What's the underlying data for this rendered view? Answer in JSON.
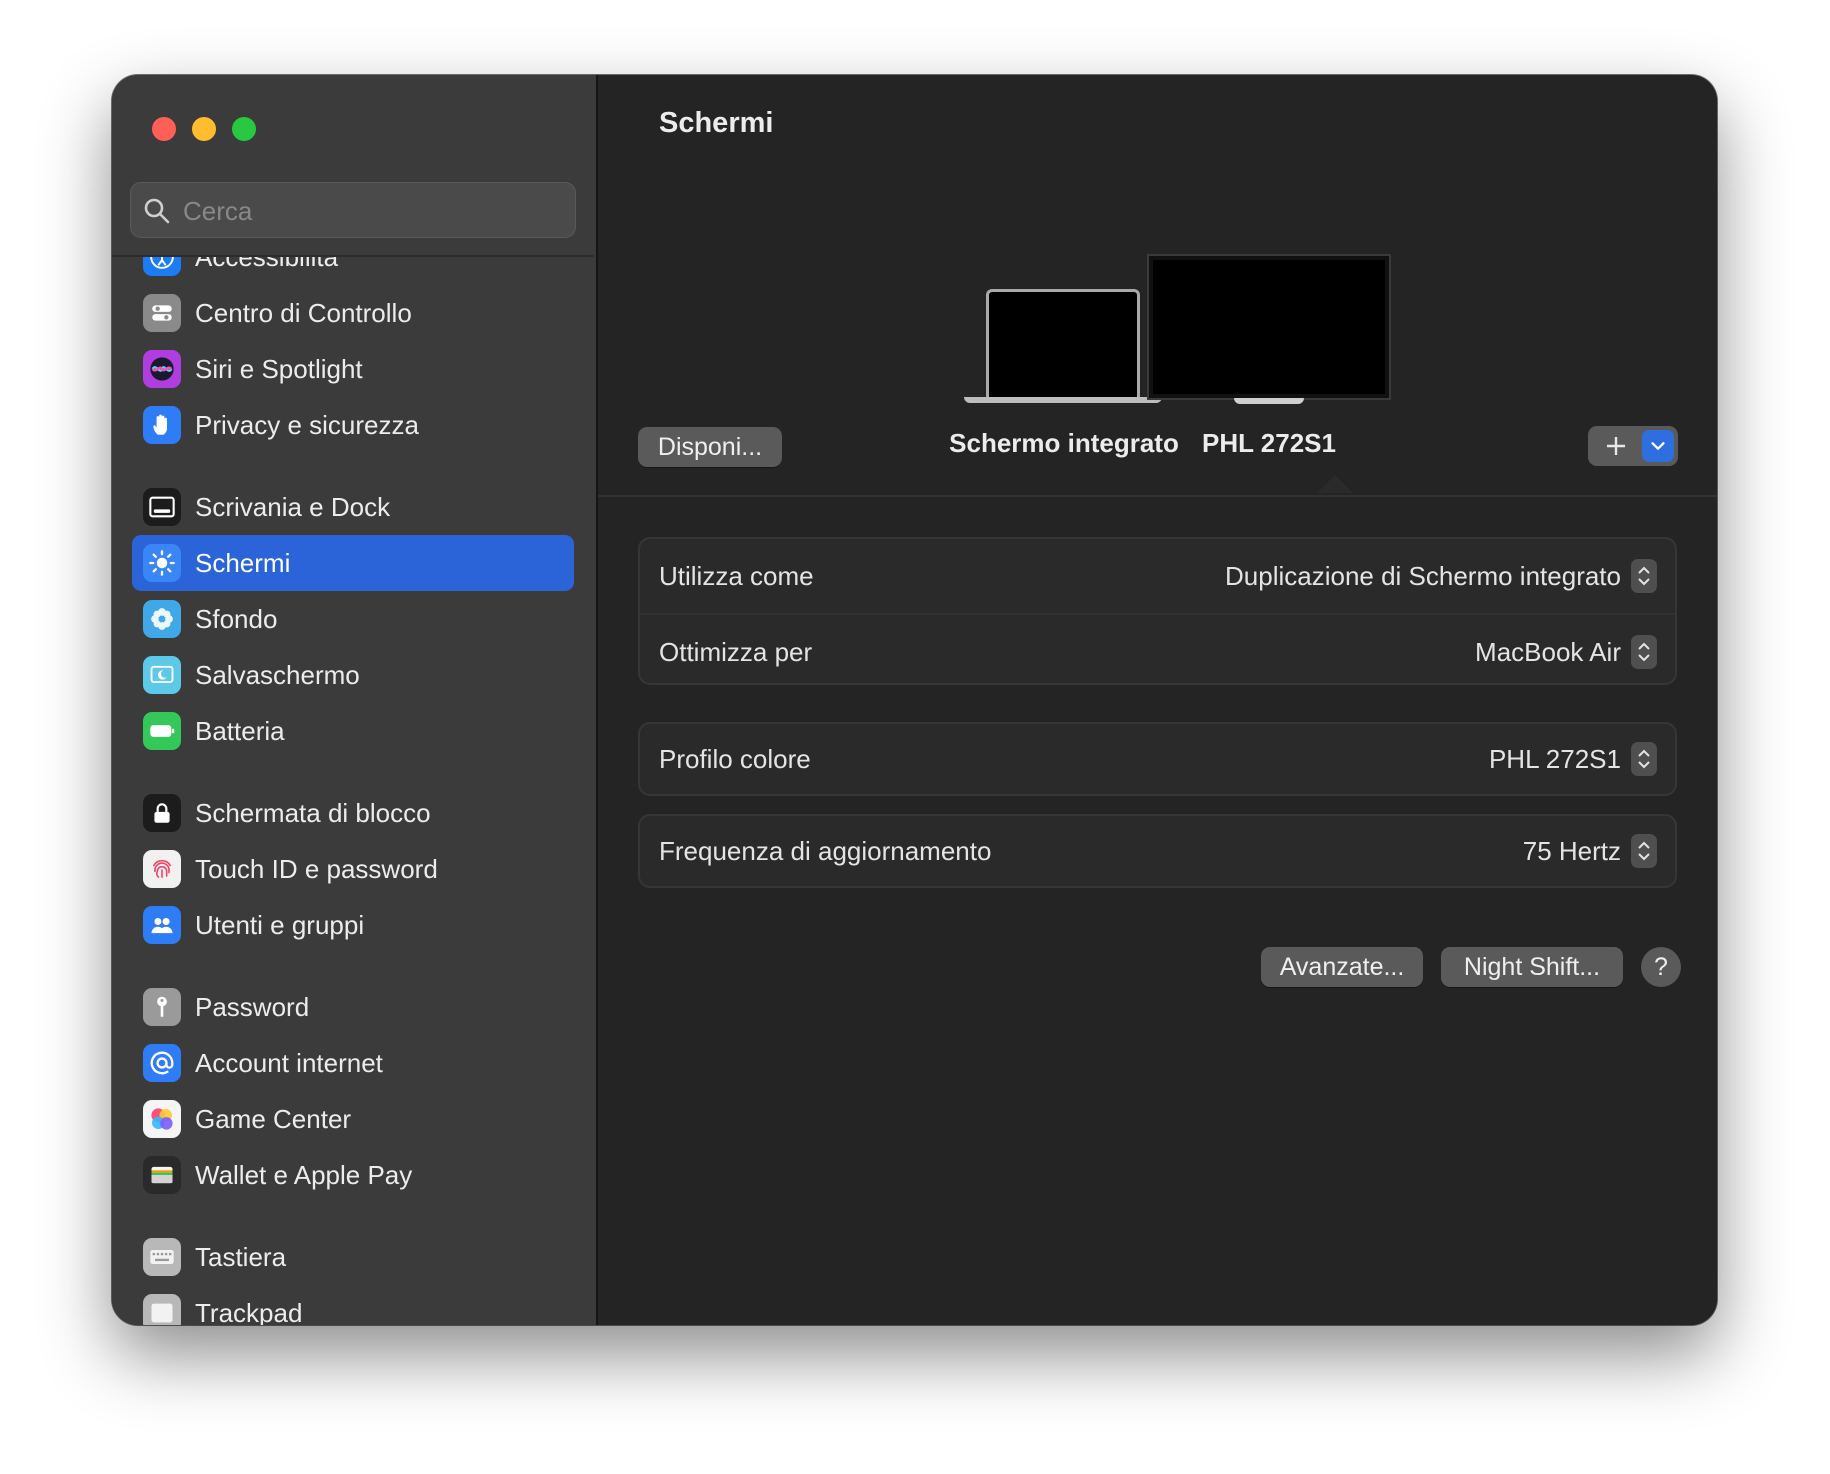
{
  "window": {
    "title": "Schermi"
  },
  "search": {
    "placeholder": "Cerca",
    "icon": "search-icon"
  },
  "sidebar": {
    "groups": [
      [
        {
          "label": "Accessibilità",
          "icon": "accessibility-icon",
          "color": "#1b7cf3"
        },
        {
          "label": "Centro di Controllo",
          "icon": "control-center-icon",
          "color": "#8a8a8a"
        },
        {
          "label": "Siri e Spotlight",
          "icon": "siri-icon",
          "color": "#b03de0"
        },
        {
          "label": "Privacy e sicurezza",
          "icon": "hand-icon",
          "color": "#2e7cf6"
        }
      ],
      [
        {
          "label": "Scrivania e Dock",
          "icon": "dock-icon",
          "color": "#1c1c1c"
        },
        {
          "label": "Schermi",
          "icon": "brightness-icon",
          "color": "#3a86f7",
          "selected": true
        },
        {
          "label": "Sfondo",
          "icon": "wallpaper-icon",
          "color": "#41a8e8"
        },
        {
          "label": "Salvaschermo",
          "icon": "screensaver-icon",
          "color": "#5cc9e8"
        },
        {
          "label": "Batteria",
          "icon": "battery-icon",
          "color": "#34c759"
        }
      ],
      [
        {
          "label": "Schermata di blocco",
          "icon": "lock-icon",
          "color": "#1c1c1c"
        },
        {
          "label": "Touch ID e password",
          "icon": "fingerprint-icon",
          "color": "#f1f1f1"
        },
        {
          "label": "Utenti e gruppi",
          "icon": "users-icon",
          "color": "#2e7cf6"
        }
      ],
      [
        {
          "label": "Password",
          "icon": "key-icon",
          "color": "#9a9a9a"
        },
        {
          "label": "Account internet",
          "icon": "at-icon",
          "color": "#2e7cf6"
        },
        {
          "label": "Game Center",
          "icon": "game-center-icon",
          "color": "#f5f5f5"
        },
        {
          "label": "Wallet e Apple Pay",
          "icon": "wallet-icon",
          "color": "#2a2a2a"
        }
      ],
      [
        {
          "label": "Tastiera",
          "icon": "keyboard-icon",
          "color": "#b8b8b8"
        },
        {
          "label": "Trackpad",
          "icon": "trackpad-icon",
          "color": "#b8b8b8"
        }
      ]
    ]
  },
  "displays": {
    "arrange_button": "Disponi...",
    "builtin_label": "Schermo integrato",
    "external_label": "PHL 272S1",
    "add_icon": "plus-icon",
    "menu_icon": "chevron-down-icon"
  },
  "settings": {
    "use_as": {
      "label": "Utilizza come",
      "value": "Duplicazione di Schermo integrato"
    },
    "optimize_for": {
      "label": "Ottimizza per",
      "value": "MacBook Air"
    },
    "color_profile": {
      "label": "Profilo colore",
      "value": "PHL 272S1"
    },
    "refresh_rate": {
      "label": "Frequenza di aggiornamento",
      "value": "75 Hertz"
    }
  },
  "footer": {
    "advanced": "Avanzate...",
    "night_shift": "Night Shift...",
    "help": "?"
  },
  "colors": {
    "accent": "#2b63d9",
    "sidebar_bg": "#3b3b3b",
    "main_bg": "#242424"
  }
}
